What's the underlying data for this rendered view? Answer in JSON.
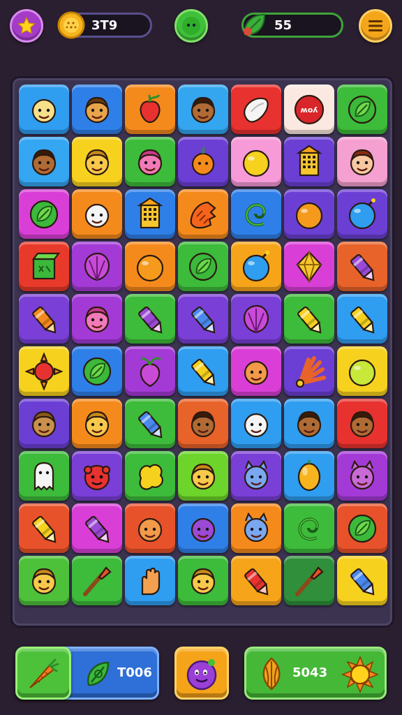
{
  "hud": {
    "coins_value": "3T9",
    "leaves_value": "55",
    "star_icon": "star-icon",
    "coin_icon": "coin-icon",
    "orb_icon": "green-orb-icon",
    "leaf_icon": "leaf-icon",
    "menu_icon": "hamburger-menu-icon"
  },
  "board": {
    "rows": [
      [
        {
          "color": "#2f9df0",
          "icon": "face"
        },
        {
          "color": "#2f7fe8",
          "icon": "face-side"
        },
        {
          "color": "#f58a1c",
          "icon": "fruit-red"
        },
        {
          "color": "#33a6ef",
          "icon": "face-brown"
        },
        {
          "color": "#e8322f",
          "icon": "bean"
        },
        {
          "color": "#fbe8e0",
          "icon": "sign",
          "text": "ʍoʎ"
        },
        {
          "color": "#3dbb3a",
          "icon": "leaf"
        }
      ],
      [
        {
          "color": "#35a6f2",
          "icon": "face-brown"
        },
        {
          "color": "#f6d11e",
          "icon": "face-yellow"
        },
        {
          "color": "#3dbb3a",
          "icon": "face-pink"
        },
        {
          "color": "#6b3fd4",
          "icon": "fruit-orange"
        },
        {
          "color": "#f69ad8",
          "icon": "ball-yellow"
        },
        {
          "color": "#6b3fd4",
          "icon": "building"
        },
        {
          "color": "#f4a0d0",
          "icon": "face-girl"
        }
      ],
      [
        {
          "color": "#d93fd6",
          "icon": "leaf"
        },
        {
          "color": "#f58a1c",
          "icon": "face-white"
        },
        {
          "color": "#2f7fe8",
          "icon": "building"
        },
        {
          "color": "#f58a1c",
          "icon": "claw"
        },
        {
          "color": "#2f7fe8",
          "icon": "swirl"
        },
        {
          "color": "#6b3fd4",
          "icon": "ball-orange"
        },
        {
          "color": "#6b3fd4",
          "icon": "bomb"
        }
      ],
      [
        {
          "color": "#e83a2a",
          "icon": "box"
        },
        {
          "color": "#a33ad6",
          "icon": "shell"
        },
        {
          "color": "#f58a1c",
          "icon": "ball-orange"
        },
        {
          "color": "#3dbb3a",
          "icon": "leaf"
        },
        {
          "color": "#f6a51a",
          "icon": "bomb"
        },
        {
          "color": "#d93fd6",
          "icon": "diamond"
        },
        {
          "color": "#e8632a",
          "icon": "crayon-purple"
        }
      ],
      [
        {
          "color": "#7a3fd6",
          "icon": "crayon-orange"
        },
        {
          "color": "#a33ad6",
          "icon": "face-pink"
        },
        {
          "color": "#3dbb3a",
          "icon": "crayon-purple"
        },
        {
          "color": "#7a3fd6",
          "icon": "crayon-blue"
        },
        {
          "color": "#7a3fd6",
          "icon": "shell"
        },
        {
          "color": "#3dbb3a",
          "icon": "crayon-yellow"
        },
        {
          "color": "#2f9df0",
          "icon": "crayon-yellow"
        }
      ],
      [
        {
          "color": "#f6d11e",
          "icon": "sun"
        },
        {
          "color": "#2f7fe8",
          "icon": "leaf"
        },
        {
          "color": "#a33ad6",
          "icon": "turnip"
        },
        {
          "color": "#2f9df0",
          "icon": "crayon-yellow"
        },
        {
          "color": "#d93fd6",
          "icon": "face-orange"
        },
        {
          "color": "#6b3fd4",
          "icon": "fan"
        },
        {
          "color": "#f6d11e",
          "icon": "ball-lime"
        }
      ],
      [
        {
          "color": "#6b3fd4",
          "icon": "bear"
        },
        {
          "color": "#f58a1c",
          "icon": "face-yellow"
        },
        {
          "color": "#3dbb3a",
          "icon": "crayon-blue"
        },
        {
          "color": "#e8632a",
          "icon": "face-brown"
        },
        {
          "color": "#2f9df0",
          "icon": "face-white"
        },
        {
          "color": "#2f9df0",
          "icon": "face-brown"
        },
        {
          "color": "#e8322f",
          "icon": "face-brown"
        }
      ],
      [
        {
          "color": "#3dbb3a",
          "icon": "ghost"
        },
        {
          "color": "#7a3fd6",
          "icon": "monster-red"
        },
        {
          "color": "#3dbb3a",
          "icon": "blob-yellow"
        },
        {
          "color": "#6cd42a",
          "icon": "face-yellow"
        },
        {
          "color": "#7a3fd6",
          "icon": "cat-blue"
        },
        {
          "color": "#2f9df0",
          "icon": "lemon"
        },
        {
          "color": "#a33ad6",
          "icon": "cat-purple"
        }
      ],
      [
        {
          "color": "#e8522a",
          "icon": "crayon-yellow"
        },
        {
          "color": "#d93fd6",
          "icon": "crayon-purple"
        },
        {
          "color": "#e8522a",
          "icon": "face-orange"
        },
        {
          "color": "#2f7fe8",
          "icon": "face-purple"
        },
        {
          "color": "#f58a1c",
          "icon": "cat-blue"
        },
        {
          "color": "#3dbb3a",
          "icon": "swirl"
        },
        {
          "color": "#e8522a",
          "icon": "leaf"
        }
      ],
      [
        {
          "color": "#4ec13a",
          "icon": "face-yellow"
        },
        {
          "color": "#3dbb3a",
          "icon": "brush"
        },
        {
          "color": "#2f9df0",
          "icon": "hand"
        },
        {
          "color": "#3dbb3a",
          "icon": "face-yellow"
        },
        {
          "color": "#f6a51a",
          "icon": "crayon-red"
        },
        {
          "color": "#2f8f3a",
          "icon": "brush"
        },
        {
          "color": "#f6d11e",
          "icon": "crayon-blue"
        }
      ]
    ]
  },
  "bottom_bar": {
    "left_value": "T006",
    "right_value": "5043",
    "left_tool_icon": "carrot-icon",
    "left_leaf_icon": "leaf-icon",
    "center_icon": "purple-creature-icon",
    "right_seed_icon": "seed-icon",
    "right_sun_icon": "sun-icon"
  }
}
